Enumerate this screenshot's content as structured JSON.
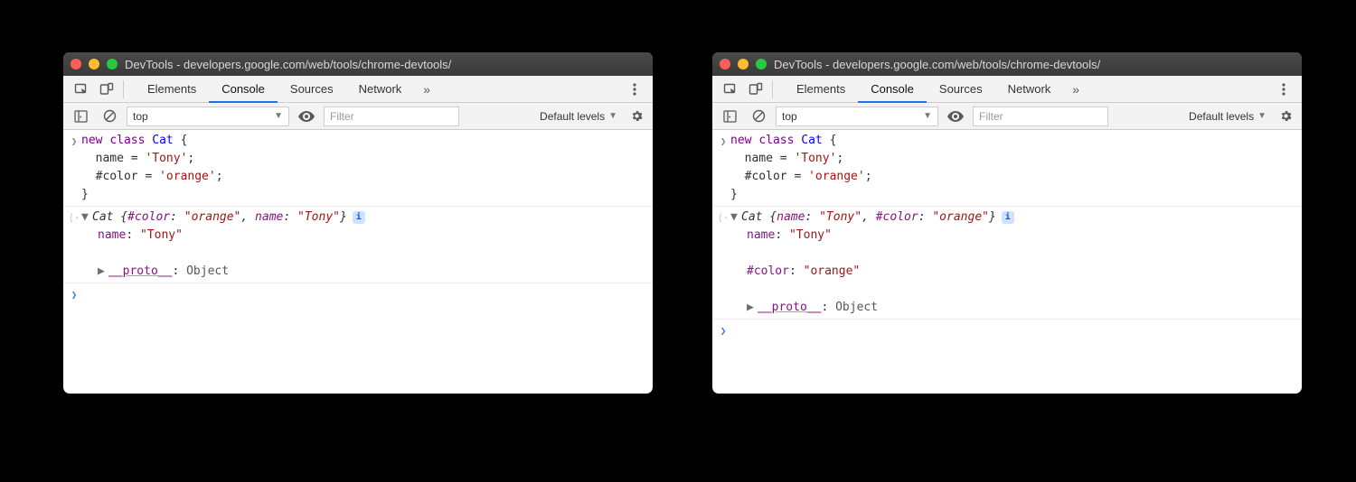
{
  "windows": [
    {
      "title": "DevTools - developers.google.com/web/tools/chrome-devtools/",
      "tabs": {
        "elements": "Elements",
        "console": "Console",
        "sources": "Sources",
        "network": "Network",
        "active": "console"
      },
      "toolbar": {
        "context": "top",
        "filter_placeholder": "Filter",
        "levels": "Default levels"
      },
      "input_code": "new class Cat {\n  name = 'Tony';\n  #color = 'orange';\n}",
      "output": {
        "header": "Cat {#color: \"orange\", name: \"Tony\"}",
        "props": [
          {
            "name": "name",
            "value": "\"Tony\""
          }
        ],
        "proto": {
          "label": "__proto__",
          "value": "Object"
        }
      }
    },
    {
      "title": "DevTools - developers.google.com/web/tools/chrome-devtools/",
      "tabs": {
        "elements": "Elements",
        "console": "Console",
        "sources": "Sources",
        "network": "Network",
        "active": "console"
      },
      "toolbar": {
        "context": "top",
        "filter_placeholder": "Filter",
        "levels": "Default levels"
      },
      "input_code": "new class Cat {\n  name = 'Tony';\n  #color = 'orange';\n}",
      "output": {
        "header": "Cat {name: \"Tony\", #color: \"orange\"}",
        "props": [
          {
            "name": "name",
            "value": "\"Tony\""
          },
          {
            "name": "#color",
            "value": "\"orange\""
          }
        ],
        "proto": {
          "label": "__proto__",
          "value": "Object"
        }
      }
    }
  ]
}
